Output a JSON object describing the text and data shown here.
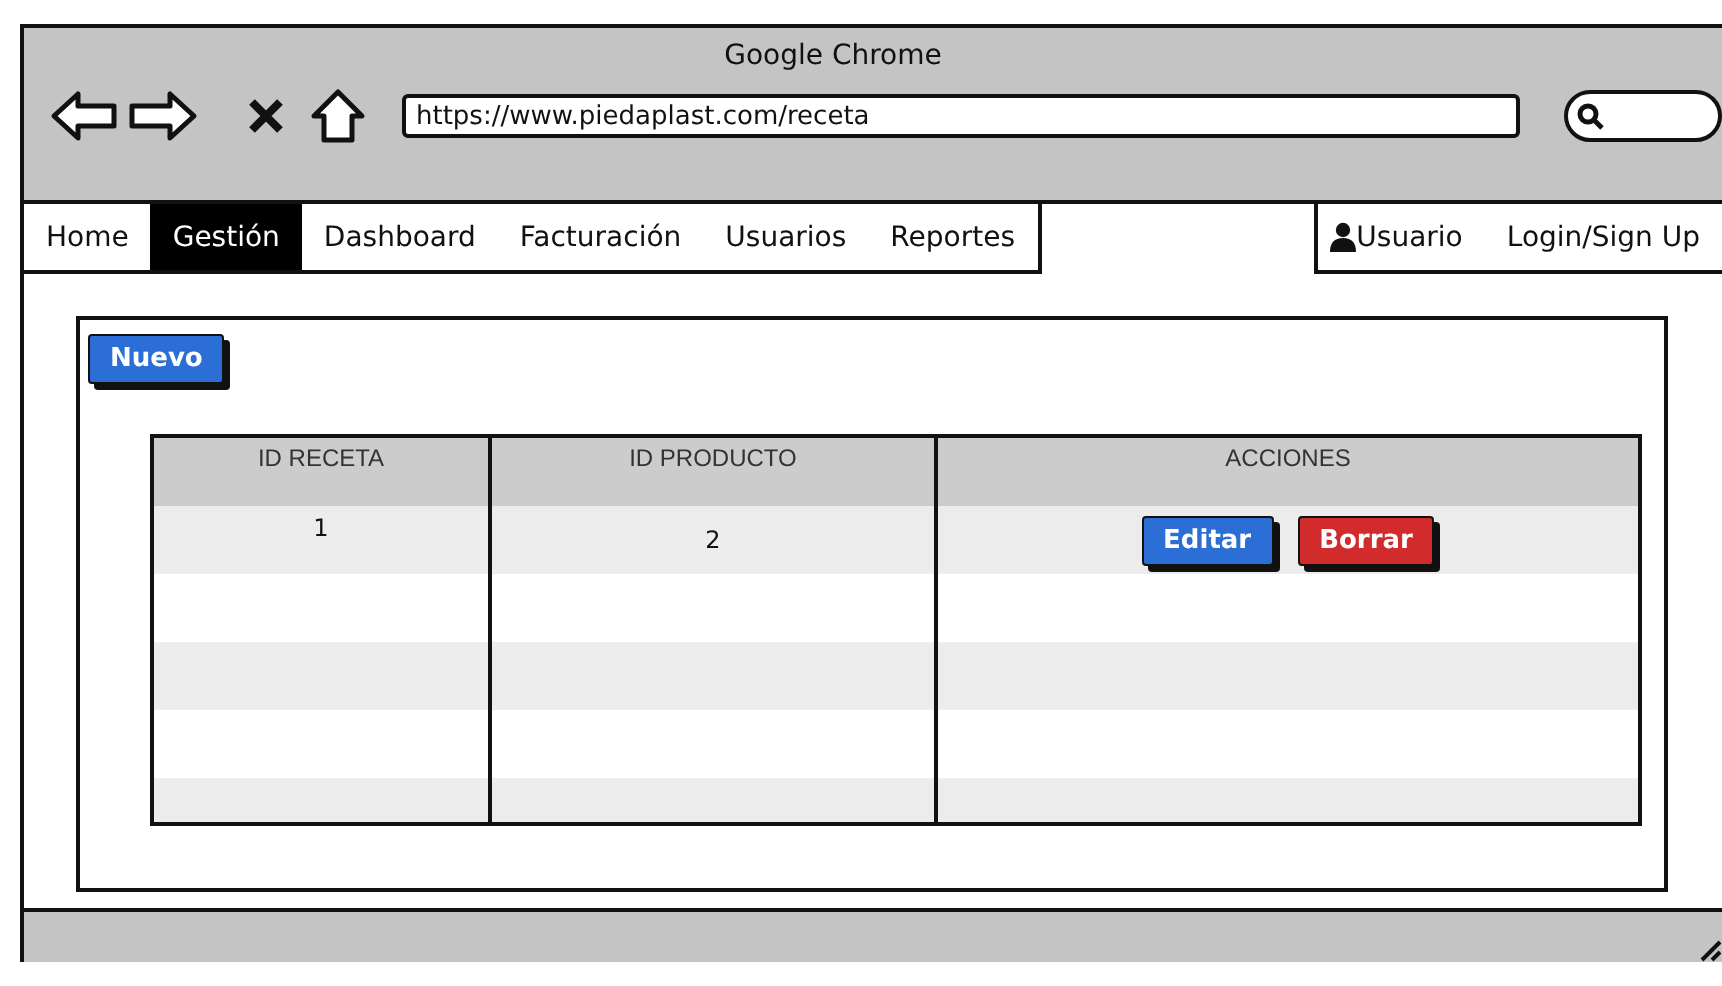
{
  "window": {
    "title": "Google Chrome"
  },
  "address_bar": {
    "value": "https://www.piedaplast.com/receta"
  },
  "nav": {
    "items": [
      {
        "label": "Home",
        "selected": false
      },
      {
        "label": "Gestión",
        "selected": true
      },
      {
        "label": "Dashboard",
        "selected": false
      },
      {
        "label": "Facturación",
        "selected": false
      },
      {
        "label": "Usuarios",
        "selected": false
      },
      {
        "label": "Reportes",
        "selected": false
      }
    ],
    "user_items": [
      {
        "label": "Usuario",
        "kind": "user"
      },
      {
        "label": "Login/Sign Up",
        "kind": "link"
      }
    ]
  },
  "new_button": "Nuevo",
  "table": {
    "columns": [
      "ID RECETA",
      "ID PRODUCTO",
      "ACCIONES"
    ],
    "rows": [
      {
        "id_receta": "1",
        "id_producto": "2",
        "actions": [
          {
            "label": "Editar",
            "kind": "primary"
          },
          {
            "label": "Borrar",
            "kind": "danger"
          }
        ]
      }
    ]
  }
}
